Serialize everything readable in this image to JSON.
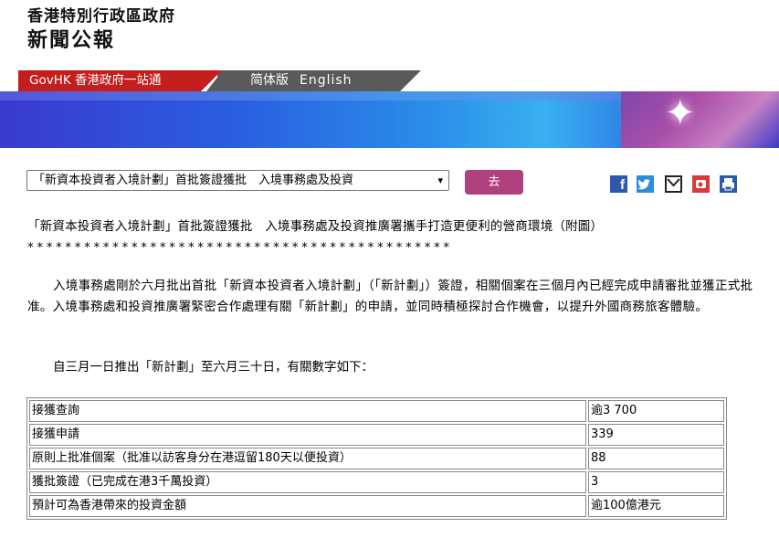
{
  "masthead": {
    "line1": "香港特別行政區政府",
    "line2": "新聞公報"
  },
  "nav": {
    "govhk": "GovHK 香港政府一站通",
    "simplified": "简体版",
    "english": "English"
  },
  "select": {
    "value": "「新資本投資者入境計劃」首批簽證獲批　入境事務處及投資",
    "arrow": "▾"
  },
  "go_button": "去",
  "share": {
    "facebook": "f"
  },
  "article": {
    "title": "「新資本投資者入境計劃」首批簽證獲批　入境事務處及投資推廣署攜手打造更便利的營商環境（附圖）",
    "stars": "*********************************************",
    "para1": "入境事務處剛於六月批出首批「新資本投資者入境計劃」（「新計劃」）簽證，相關個案在三個月內已經完成申請審批並獲正式批准。入境事務處和投資推廣署緊密合作處理有關「新計劃」的申請，並同時積極探討合作機會，以提升外國商務旅客體驗。",
    "para2": "自三月一日推出「新計劃」至六月三十日，有關數字如下："
  },
  "table": {
    "rows": [
      {
        "label": "接獲查詢",
        "value": "逾3 700"
      },
      {
        "label": "接獲申請",
        "value": "339"
      },
      {
        "label": "原則上批准個案（批准以訪客身分在港逗留180天以便投資）",
        "value": "88"
      },
      {
        "label": "獲批簽證（已完成在港3千萬投資）",
        "value": "3"
      },
      {
        "label": "預計可為香港帶來的投資金額",
        "value": "逾100億港元"
      }
    ]
  }
}
